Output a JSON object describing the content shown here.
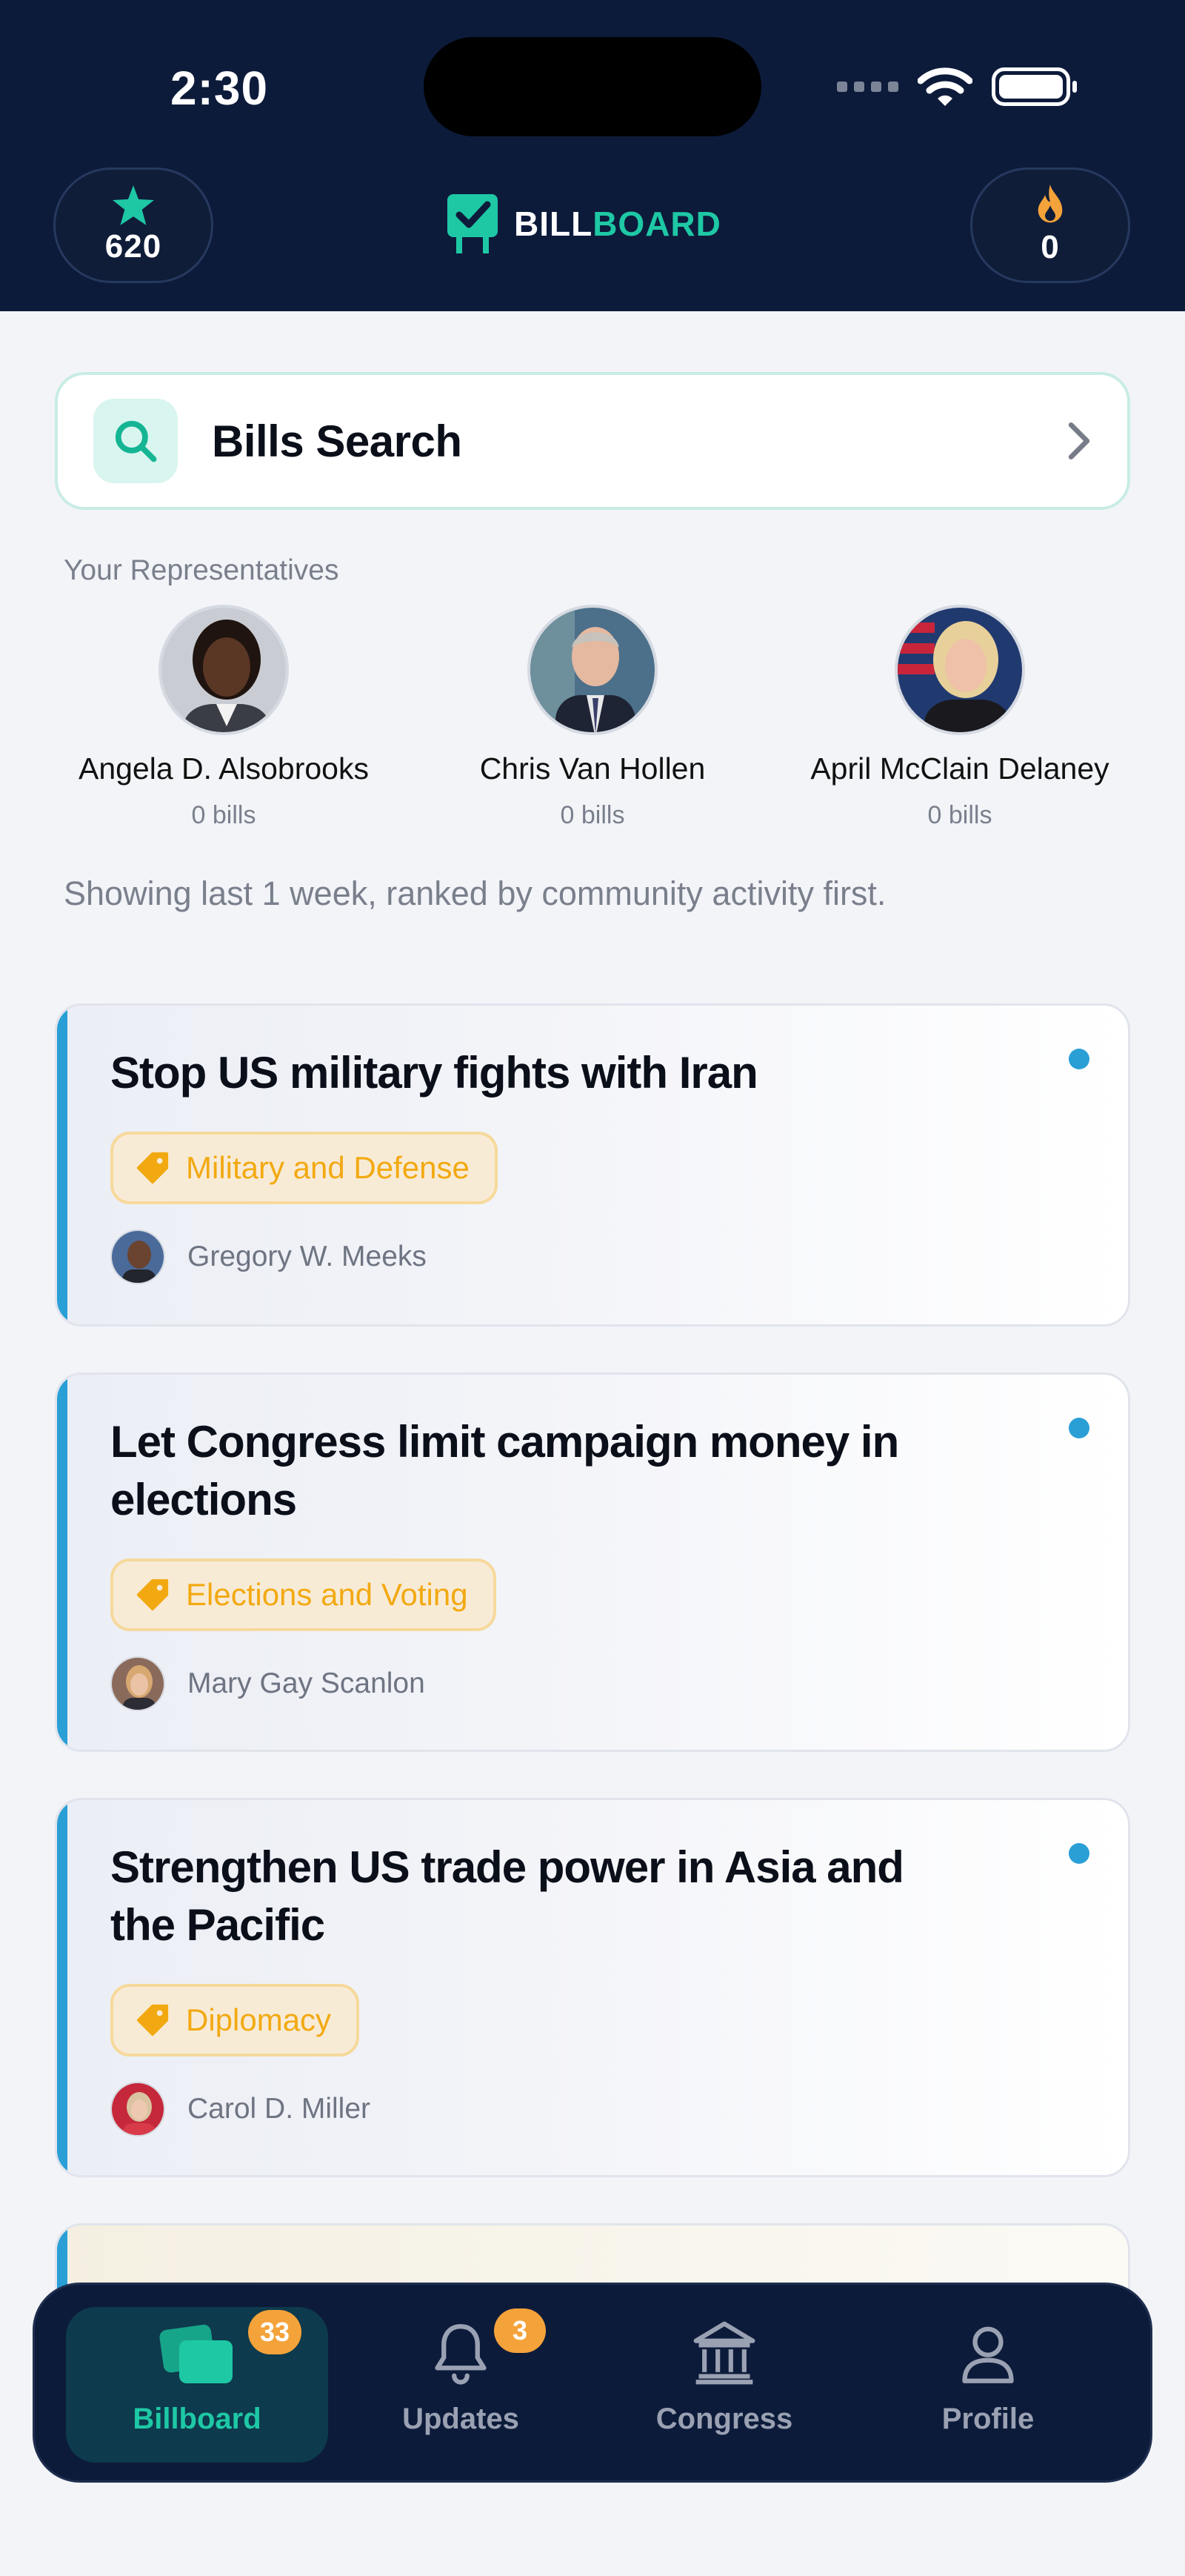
{
  "status_bar": {
    "time": "2:30"
  },
  "header": {
    "stars_value": "620",
    "streak_value": "0",
    "logo_part1": "BILL",
    "logo_part2": "BOARD"
  },
  "search": {
    "label": "Bills Search"
  },
  "representatives": {
    "title": "Your Representatives",
    "items": [
      {
        "name": "Angela D. Alsobrooks",
        "count": "0 bills"
      },
      {
        "name": "Chris Van Hollen",
        "count": "0 bills"
      },
      {
        "name": "April McClain Delaney",
        "count": "0 bills"
      }
    ]
  },
  "info_text": "Showing last 1 week, ranked by community activity first.",
  "bills": [
    {
      "title": "Stop US military fights with Iran",
      "tag": "Military and Defense",
      "sponsor": "Gregory W. Meeks"
    },
    {
      "title": "Let Congress limit campaign money in elections",
      "tag": "Elections and Voting",
      "sponsor": "Mary Gay Scanlon"
    },
    {
      "title": "Strengthen US trade power in Asia and the Pacific",
      "tag": "Diplomacy",
      "sponsor": "Carol D. Miller"
    }
  ],
  "nav": {
    "items": [
      {
        "label": "Billboard",
        "badge": "33"
      },
      {
        "label": "Updates",
        "badge": "3"
      },
      {
        "label": "Congress"
      },
      {
        "label": "Profile"
      }
    ]
  },
  "colors": {
    "navy": "#0d1b3b",
    "accent": "#1ec8a5",
    "blue": "#2a9fd6",
    "tag": "#f2a911",
    "badge": "#f4a23a"
  }
}
